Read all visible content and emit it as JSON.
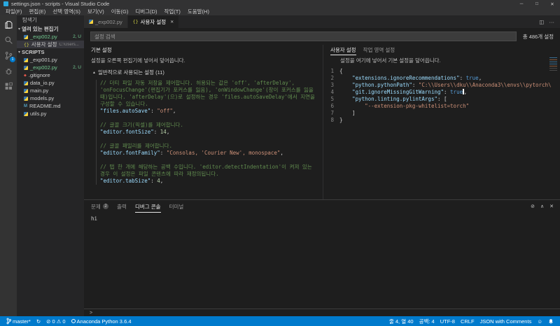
{
  "window": {
    "title": "settings.json - scripts - Visual Studio Code"
  },
  "menu": [
    "파일(F)",
    "편집(E)",
    "선택 영역(S)",
    "보기(V)",
    "이동(G)",
    "디버그(D)",
    "작업(T)",
    "도움말(H)"
  ],
  "icons": {
    "minimize": "─",
    "maximize": "□",
    "close": "✕",
    "chevron_down": "▾",
    "fold_up": "▲",
    "json_glyph": "{}",
    "markdown_glyph": "M",
    "git_glyph": "◆",
    "split_editor": "◫",
    "more_actions": "···",
    "tab_close": "✕",
    "sync": "↻",
    "error": "⊘",
    "warning": "⚠",
    "smiley": "☺",
    "panel_clear": "⊘",
    "panel_maximize": "∧",
    "panel_close": "✕",
    "prompt": ">"
  },
  "activity": {
    "scm_badge": "1"
  },
  "sidebar": {
    "title": "탐색기",
    "open_editors_label": "열려 있는 편집기",
    "open_editors": [
      {
        "name": "_exp002.py",
        "badge": "2, U"
      },
      {
        "name": "사용자 설정",
        "detail": "C:\\Users..."
      }
    ],
    "folder_label": "SCRIPTS",
    "files": [
      {
        "name": "_exp001.py"
      },
      {
        "name": "_exp002.py",
        "badge": "2, U"
      },
      {
        "name": ".gitignore"
      },
      {
        "name": "data_io.py"
      },
      {
        "name": "main.py"
      },
      {
        "name": "models.py"
      },
      {
        "name": "README.md"
      },
      {
        "name": "utils.py"
      }
    ]
  },
  "tabs": {
    "tab1": "_exp002.py",
    "tab2": "사용자 설정"
  },
  "settings_editor": {
    "search_placeholder": "설정 검색",
    "result_count": "총 486개 설정",
    "default_pane": {
      "title": "기본 설정",
      "description": "설정을 오른쪽 편집기에 넣어서 덮어씁니다.",
      "section_title": "일반적으로 사용되는 설정 (11)",
      "lines": [
        {
          "segs": [
            [
              "cmt",
              "// 더티 파일 자동 저장을 제어합니다. 허용되는 값은 'off', 'afterDelay',"
            ]
          ]
        },
        {
          "segs": [
            [
              "cmt",
              "'onFocusChange'(편집기가 포커스를 잃음), 'onWindowChange'(창이 포커스를 잃을"
            ]
          ]
        },
        {
          "segs": [
            [
              "cmt",
              "때)입니다. 'afterDelay'(으)로 설정하는 경우 'files.autoSaveDelay'에서 지연을"
            ]
          ]
        },
        {
          "segs": [
            [
              "cmt",
              "구성할 수 있습니다."
            ]
          ]
        },
        {
          "segs": [
            [
              "key",
              "\"files.autoSave\""
            ],
            [
              "pun",
              ": "
            ],
            [
              "str",
              "\"off\""
            ],
            [
              "pun",
              ","
            ]
          ]
        },
        {
          "segs": []
        },
        {
          "segs": [
            [
              "cmt",
              "// 글꼴 크기(픽셀)를 제어합니다."
            ]
          ]
        },
        {
          "segs": [
            [
              "key",
              "\"editor.fontSize\""
            ],
            [
              "pun",
              ": "
            ],
            [
              "num",
              "14"
            ],
            [
              "pun",
              ","
            ]
          ]
        },
        {
          "segs": []
        },
        {
          "segs": [
            [
              "cmt",
              "// 글꼴 패밀리를 제어합니다."
            ]
          ]
        },
        {
          "segs": [
            [
              "key",
              "\"editor.fontFamily\""
            ],
            [
              "pun",
              ": "
            ],
            [
              "str",
              "\"Consolas, 'Courier New', monospace\""
            ],
            [
              "pun",
              ","
            ]
          ]
        },
        {
          "segs": []
        },
        {
          "segs": [
            [
              "cmt",
              "// 탭 한 개에 해당하는 공백 수입니다. 'editor.detectIndentation'이 켜져 있는"
            ]
          ]
        },
        {
          "segs": [
            [
              "cmt",
              "경우 이 설정은 파일 콘텐츠에 따라 재정의됩니다."
            ]
          ]
        },
        {
          "segs": [
            [
              "key",
              "\"editor.tabSize\""
            ],
            [
              "pun",
              ": "
            ],
            [
              "num",
              "4"
            ],
            [
              "pun",
              ","
            ]
          ]
        }
      ]
    },
    "user_pane": {
      "tab_user": "사용자 설정",
      "tab_workspace": "작업 영역 설정",
      "description": "설정을 여기에 넣어서 기본 설정을 덮어씁니다.",
      "lines": [
        {
          "num": "1",
          "segs": [
            [
              "pun",
              "{"
            ]
          ]
        },
        {
          "num": "2",
          "segs": [
            [
              "pun",
              "    "
            ],
            [
              "key",
              "\"extensions.ignoreRecommendations\""
            ],
            [
              "pun",
              ": "
            ],
            [
              "kw",
              "true"
            ],
            [
              "pun",
              ","
            ]
          ]
        },
        {
          "num": "3",
          "segs": [
            [
              "pun",
              "    "
            ],
            [
              "key",
              "\"python.pythonPath\""
            ],
            [
              "pun",
              ": "
            ],
            [
              "str",
              "\"C:\\\\Users\\\\dku\\\\Anaconda3\\\\envs\\\\pytorch\\"
            ]
          ]
        },
        {
          "num": "4",
          "segs": [
            [
              "pun",
              "    "
            ],
            [
              "key",
              "\"git.ignoreMissingGitWarning\""
            ],
            [
              "pun",
              ": "
            ],
            [
              "kw",
              "true"
            ],
            [
              "cur",
              ""
            ],
            [
              "pun",
              ","
            ]
          ]
        },
        {
          "num": "5",
          "segs": [
            [
              "pun",
              "    "
            ],
            [
              "key",
              "\"python.linting.pylintArgs\""
            ],
            [
              "pun",
              ": ["
            ]
          ]
        },
        {
          "num": "6",
          "segs": [
            [
              "pun",
              "        "
            ],
            [
              "str",
              "\"--extension-pkg-whitelist=torch\""
            ]
          ]
        },
        {
          "num": "7",
          "segs": [
            [
              "pun",
              "    ]"
            ]
          ]
        },
        {
          "num": "8",
          "segs": [
            [
              "pun",
              "}"
            ]
          ]
        }
      ]
    }
  },
  "panel": {
    "tab_problems": "문제",
    "problems_badge": "2",
    "tab_output": "출력",
    "tab_debug": "디버그 콘솔",
    "tab_terminal": "터미널",
    "console_output": "hi"
  },
  "status": {
    "branch": "master*",
    "errors": "0",
    "warnings": "0",
    "python": "Anaconda Python 3.6.4",
    "line_col": "줄 4, 열 40",
    "spaces": "공백: 4",
    "encoding": "UTF-8",
    "eol": "CRLF",
    "language": "JSON with Comments"
  },
  "colors": {
    "statusbar": "#007acc",
    "badge_accent": "#007acc",
    "git_untracked": "#73c991",
    "comment": "#608b4e",
    "property": "#9cdcfe",
    "string": "#ce9178",
    "number": "#b5cea8",
    "keyword": "#569cd6",
    "editor_bg": "#1e1e1e",
    "sidebar_bg": "#252526",
    "titlebar_bg": "#323233"
  }
}
